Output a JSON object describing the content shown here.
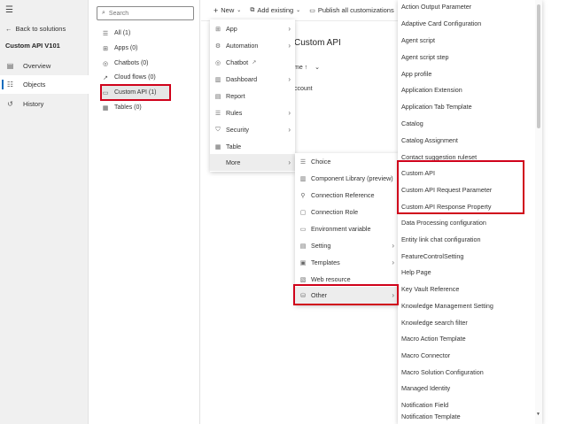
{
  "nav": {
    "back_label": "Back to solutions",
    "solution_title": "Custom API V101",
    "items": [
      {
        "label": "Overview",
        "icon": "overview-icon"
      },
      {
        "label": "Objects",
        "icon": "objects-icon"
      },
      {
        "label": "History",
        "icon": "history-icon"
      }
    ]
  },
  "search": {
    "placeholder": "Search"
  },
  "tree": [
    {
      "label": "All  (1)",
      "icon": "list-icon"
    },
    {
      "label": "Apps  (0)",
      "icon": "apps-icon"
    },
    {
      "label": "Chatbots  (0)",
      "icon": "chatbot-icon"
    },
    {
      "label": "Cloud flows  (0)",
      "icon": "flow-icon"
    },
    {
      "label": "Custom API  (1)",
      "icon": "folder-icon"
    },
    {
      "label": "Tables  (0)",
      "icon": "table-icon"
    }
  ],
  "toolbar": {
    "new_label": "New",
    "add_existing_label": "Add existing",
    "publish_label": "Publish all customizations"
  },
  "main": {
    "title": "Custom API",
    "sort_header": "me ↑",
    "row_text": "ccount"
  },
  "new_menu": [
    {
      "label": "App",
      "icon": "app-icon",
      "submenu": true
    },
    {
      "label": "Automation",
      "icon": "automation-icon",
      "submenu": true
    },
    {
      "label": "Chatbot",
      "icon": "chatbot-icon",
      "submenu": false
    },
    {
      "label": "Dashboard",
      "icon": "dashboard-icon",
      "submenu": true
    },
    {
      "label": "Report",
      "icon": "report-icon",
      "submenu": false
    },
    {
      "label": "Rules",
      "icon": "rules-icon",
      "submenu": true
    },
    {
      "label": "Security",
      "icon": "security-icon",
      "submenu": true
    },
    {
      "label": "Table",
      "icon": "table-icon",
      "submenu": false
    },
    {
      "label": "More",
      "icon": "",
      "submenu": true
    }
  ],
  "more_menu": [
    {
      "label": "Choice",
      "icon": "choice-icon",
      "submenu": false
    },
    {
      "label": "Component Library (preview)",
      "icon": "component-library-icon",
      "submenu": false
    },
    {
      "label": "Connection Reference",
      "icon": "connection-reference-icon",
      "submenu": false
    },
    {
      "label": "Connection Role",
      "icon": "connection-role-icon",
      "submenu": false
    },
    {
      "label": "Environment variable",
      "icon": "environment-variable-icon",
      "submenu": false
    },
    {
      "label": "Setting",
      "icon": "setting-icon",
      "submenu": true
    },
    {
      "label": "Templates",
      "icon": "templates-icon",
      "submenu": true
    },
    {
      "label": "Web resource",
      "icon": "web-resource-icon",
      "submenu": false
    },
    {
      "label": "Other",
      "icon": "other-icon",
      "submenu": true
    }
  ],
  "other_menu": [
    "Action Output Parameter",
    "Adaptive Card Configuration",
    "Agent script",
    "Agent script step",
    "App profile",
    "Application Extension",
    "Application Tab Template",
    "Catalog",
    "Catalog Assignment",
    "Contact suggestion ruleset",
    "Custom API",
    "Custom API Request Parameter",
    "Custom API Response Property",
    "Data Processing configuration",
    "Entity link chat configuration",
    "FeatureControlSetting",
    "Help Page",
    "Key Vault Reference",
    "Knowledge Management Setting",
    "Knowledge search filter",
    "Macro Action Template",
    "Macro Connector",
    "Macro Solution Configuration",
    "Managed Identity",
    "Notification Field",
    "Notification Template"
  ],
  "colors": {
    "highlight_box": "#d0021b",
    "accent": "#0f6cbd"
  }
}
